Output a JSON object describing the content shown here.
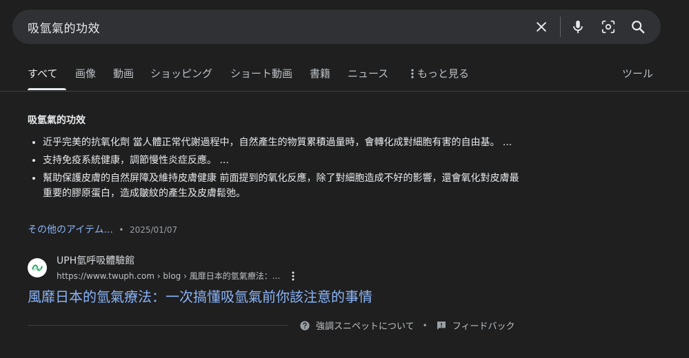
{
  "search": {
    "query": "吸氫氣的功效"
  },
  "tabs": [
    {
      "label": "すべて"
    },
    {
      "label": "画像"
    },
    {
      "label": "動画"
    },
    {
      "label": "ショッピング"
    },
    {
      "label": "ショート動画"
    },
    {
      "label": "書籍"
    },
    {
      "label": "ニュース"
    },
    {
      "label": "もっと見る"
    }
  ],
  "tools_label": "ツール",
  "snippet": {
    "title": "吸氫氣的功效",
    "bullets": [
      "近乎完美的抗氧化劑 當人體正常代謝過程中，自然產生的物質累積過量時，會轉化成對細胞有害的自由基。 ...",
      "支持免疫系統健康，調節慢性炎症反應。 ...",
      "幫助保護皮膚的自然屏障及維持皮膚健康 前面提到的氧化反應，除了對細胞造成不好的影響，還會氧化對皮膚最重要的膠原蛋白，造成皺紋的產生及皮膚鬆弛。"
    ],
    "more_link": "その他のアイテム...",
    "separator": "•",
    "date": "2025/01/07"
  },
  "result": {
    "site_name": "UPH氫呼吸體驗館",
    "url": "https://www.twuph.com › blog › 風靡日本的氫氣療法：...",
    "title": "風靡日本的氫氣療法：一次搞懂吸氫氣前你該注意的事情"
  },
  "footer": {
    "about_label": "強調スニペットについて",
    "separator": "•",
    "feedback_label": "フィードバック"
  },
  "colors": {
    "background": "#1f1f1f",
    "searchbar": "#303134",
    "link": "#8ab4f8",
    "text": "#e8eaed",
    "muted": "#9aa0a6"
  }
}
